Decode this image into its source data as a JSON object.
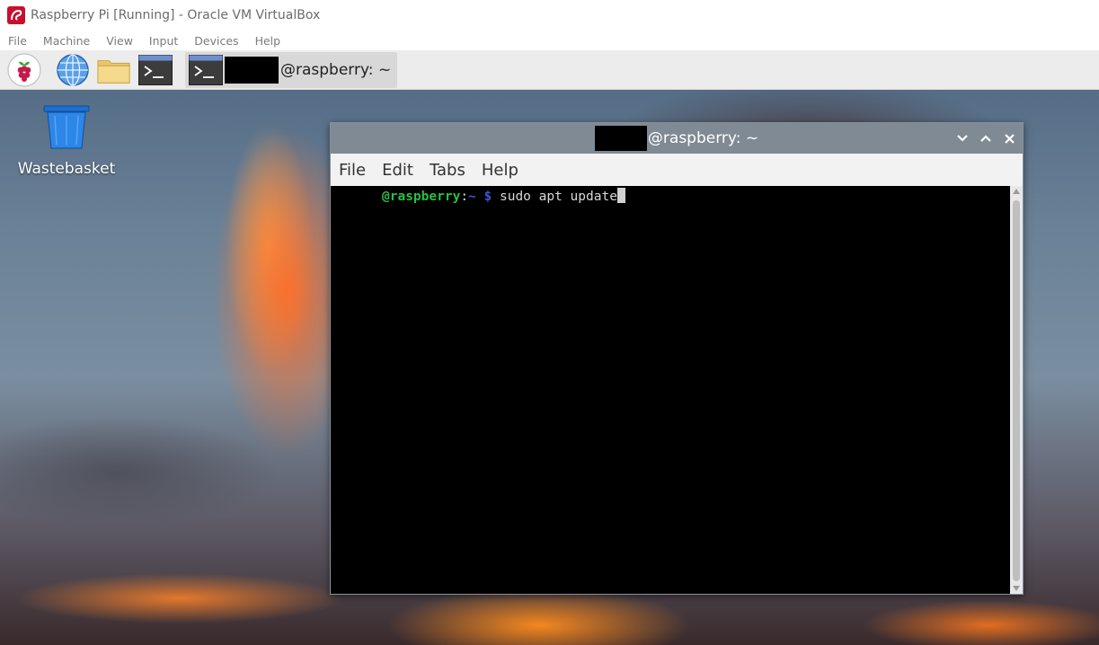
{
  "host": {
    "title": "Raspberry Pi [Running] - Oracle VM VirtualBox",
    "icon": "virtualbox-icon",
    "menu": [
      "File",
      "Machine",
      "View",
      "Input",
      "Devices",
      "Help"
    ]
  },
  "taskbar": {
    "launchers": [
      "raspberry-menu-icon",
      "web-browser-icon",
      "file-manager-icon",
      "terminal-icon"
    ],
    "task": {
      "icon": "terminal-icon",
      "label": "@raspberry: ~"
    }
  },
  "desktop": {
    "icons": [
      {
        "name": "wastebasket-icon",
        "label": "Wastebasket"
      }
    ]
  },
  "terminal": {
    "title": "@raspberry: ~",
    "menu": [
      "File",
      "Edit",
      "Tabs",
      "Help"
    ],
    "prompt": {
      "user_host": "@raspberry",
      "colon": ":",
      "path": "~ $",
      "command": " sudo apt update"
    }
  },
  "colors": {
    "prompt_user": "#28c040",
    "prompt_path": "#3a56d8",
    "terminal_titlebar": "#7f8a94",
    "taskbar": "#ececec"
  }
}
